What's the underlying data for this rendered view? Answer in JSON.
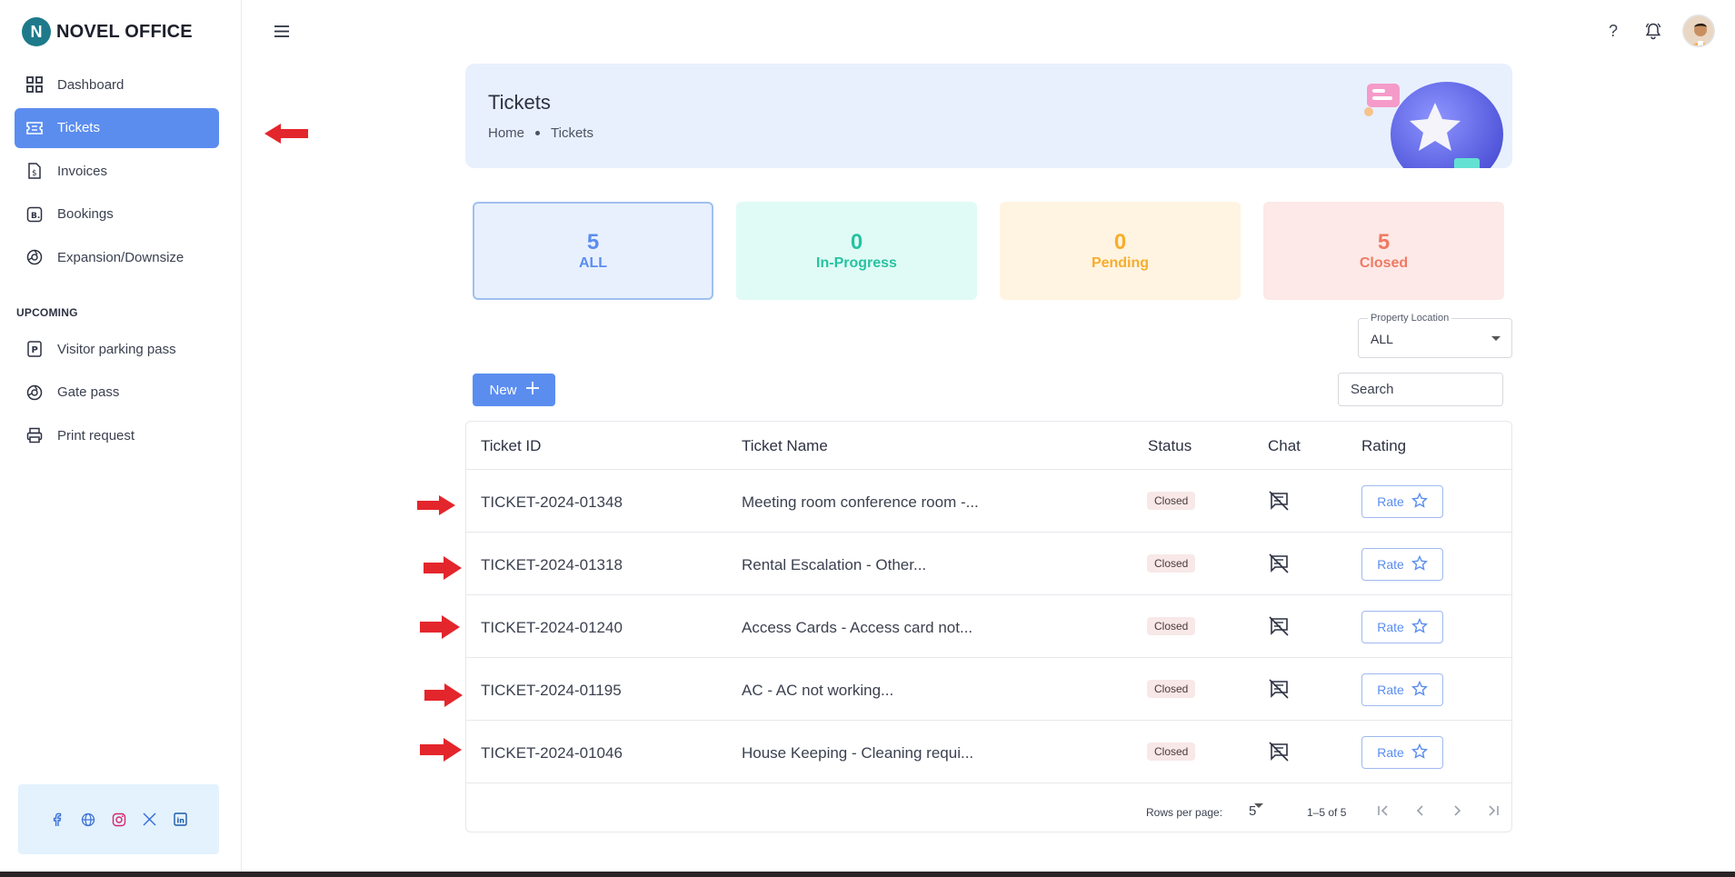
{
  "app": {
    "brand": "NOVEL OFFICE",
    "brand_mark": "N"
  },
  "sidebar": {
    "items": [
      {
        "label": "Dashboard",
        "icon": "dashboard-icon",
        "active": false
      },
      {
        "label": "Tickets",
        "icon": "ticket-icon",
        "active": true
      },
      {
        "label": "Invoices",
        "icon": "invoice-icon",
        "active": false
      },
      {
        "label": "Bookings",
        "icon": "bookings-icon",
        "active": false
      },
      {
        "label": "Expansion/Downsize",
        "icon": "expansion-icon",
        "active": false
      }
    ],
    "section_title": "UPCOMING",
    "upcoming": [
      {
        "label": "Visitor parking pass",
        "icon": "parking-icon"
      },
      {
        "label": "Gate pass",
        "icon": "gate-icon"
      },
      {
        "label": "Print request",
        "icon": "printer-icon"
      }
    ],
    "social": [
      "facebook-icon",
      "globe-icon",
      "instagram-icon",
      "x-icon",
      "linkedin-icon"
    ]
  },
  "topbar": {
    "help": "?"
  },
  "hero": {
    "title": "Tickets",
    "breadcrumb": [
      "Home",
      "Tickets"
    ]
  },
  "stats": [
    {
      "count": "5",
      "label": "ALL"
    },
    {
      "count": "0",
      "label": "In-Progress"
    },
    {
      "count": "0",
      "label": "Pending"
    },
    {
      "count": "5",
      "label": "Closed"
    }
  ],
  "filters": {
    "location_label": "Property Location",
    "location_value": "ALL",
    "search_placeholder": "Search"
  },
  "actions": {
    "new_label": "New"
  },
  "table": {
    "headers": [
      "Ticket ID",
      "Ticket Name",
      "Status",
      "Chat",
      "Rating"
    ],
    "rows": [
      {
        "id": "TICKET-2024-01348",
        "name": "Meeting room conference room -...",
        "status": "Closed",
        "rate": "Rate"
      },
      {
        "id": "TICKET-2024-01318",
        "name": "Rental Escalation - Other...",
        "status": "Closed",
        "rate": "Rate"
      },
      {
        "id": "TICKET-2024-01240",
        "name": "Access Cards - Access card not...",
        "status": "Closed",
        "rate": "Rate"
      },
      {
        "id": "TICKET-2024-01195",
        "name": "AC - AC not working...",
        "status": "Closed",
        "rate": "Rate"
      },
      {
        "id": "TICKET-2024-01046",
        "name": "House Keeping - Cleaning requi...",
        "status": "Closed",
        "rate": "Rate"
      }
    ],
    "pagination": {
      "rows_label": "Rows per page:",
      "rows_value": "5",
      "range": "1–5 of 5"
    }
  },
  "colors": {
    "accent": "#5b8def",
    "annotation_arrow": "#e3262c"
  }
}
